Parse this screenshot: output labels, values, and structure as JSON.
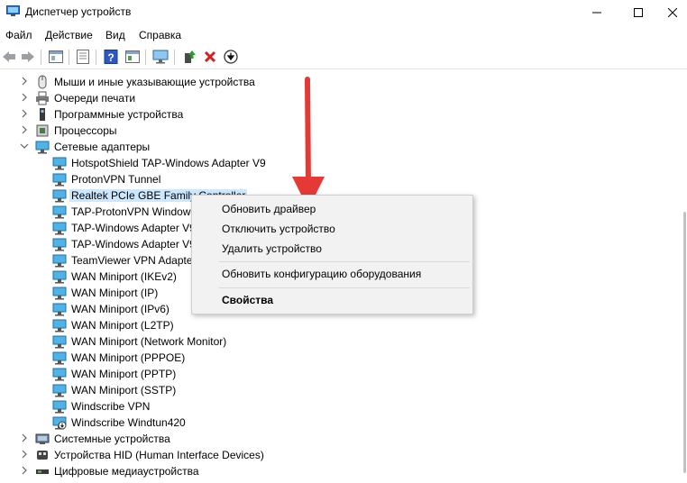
{
  "window": {
    "title": "Диспетчер устройств",
    "controls": [
      "minimize",
      "maximize",
      "close"
    ]
  },
  "menu": [
    "Файл",
    "Действие",
    "Вид",
    "Справка"
  ],
  "toolbar": {
    "icons": [
      "back-icon",
      "forward-icon",
      "properties-icon",
      "show-hidden-icon",
      "help-icon",
      "view-icon",
      "monitor-icon",
      "update-driver-icon",
      "delete-icon",
      "download-icon"
    ]
  },
  "tree": {
    "before": [
      {
        "label": "Мыши и иные указывающие устройства",
        "icon": "mouse-icon"
      },
      {
        "label": "Очереди печати",
        "icon": "printer-icon"
      },
      {
        "label": "Программные устройства",
        "icon": "software-device-icon"
      },
      {
        "label": "Процессоры",
        "icon": "cpu-icon"
      }
    ],
    "expanded": {
      "label": "Сетевые адаптеры",
      "icon": "network-adapters-icon"
    },
    "children": [
      "HotspotShield TAP-Windows Adapter V9",
      "ProtonVPN Tunnel",
      "Realtek PCIe GBE Family Controller",
      "TAP-ProtonVPN Windows",
      "TAP-Windows Adapter V9",
      "TAP-Windows Adapter V9",
      "TeamViewer VPN Adapter",
      "WAN Miniport (IKEv2)",
      "WAN Miniport (IP)",
      "WAN Miniport (IPv6)",
      "WAN Miniport (L2TP)",
      "WAN Miniport (Network Monitor)",
      "WAN Miniport (PPPOE)",
      "WAN Miniport (PPTP)",
      "WAN Miniport (SSTP)",
      "Windscribe VPN",
      "Windscribe Windtun420"
    ],
    "selected_child": "Realtek PCIe GBE Family Controller",
    "after": [
      {
        "label": "Системные устройства",
        "icon": "system-devices-icon"
      },
      {
        "label": "Устройства HID (Human Interface Devices)",
        "icon": "hid-icon"
      },
      {
        "label": "Цифровые медиаустройства",
        "icon": "media-device-icon"
      }
    ]
  },
  "context_menu": {
    "items": [
      "Обновить драйвер",
      "Отключить устройство",
      "Удалить устройство",
      "Обновить конфигурацию оборудования",
      "Свойства"
    ]
  },
  "colors": {
    "selection": "#cce8ff",
    "arrow": "#e53935",
    "menu_bg": "#f2f2f2"
  }
}
